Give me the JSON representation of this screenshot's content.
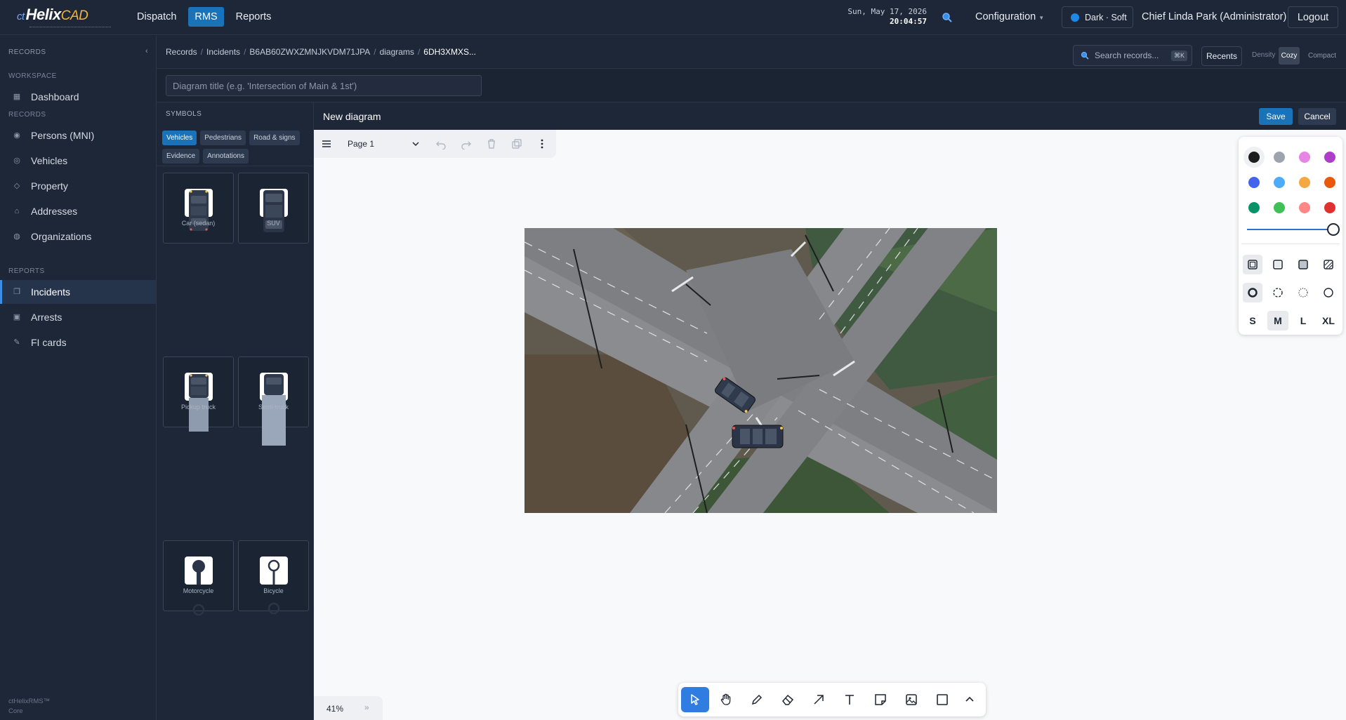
{
  "app": {
    "logo": {
      "prefix": "ct",
      "main": "Helix",
      "suffix": "CAD"
    },
    "nav": [
      {
        "label": "Dispatch",
        "active": false
      },
      {
        "label": "RMS",
        "active": true
      },
      {
        "label": "Reports",
        "active": false
      }
    ],
    "date": "Sun, May 17, 2026",
    "time": "20:04:57",
    "configuration": "Configuration",
    "theme": "Dark · Soft",
    "user": "Chief Linda Park (Administrator)",
    "logout": "Logout"
  },
  "sidebar": {
    "header": "RECORDS",
    "sections": {
      "workspace": "WORKSPACE",
      "records": "RECORDS",
      "reports": "REPORTS"
    },
    "items": [
      {
        "label": "Dashboard",
        "icon": "grid-icon"
      },
      {
        "label": "Persons (MNI)",
        "icon": "person-icon"
      },
      {
        "label": "Vehicles",
        "icon": "vehicle-icon"
      },
      {
        "label": "Property",
        "icon": "diamond-icon"
      },
      {
        "label": "Addresses",
        "icon": "home-icon"
      },
      {
        "label": "Organizations",
        "icon": "org-icon"
      },
      {
        "label": "Incidents",
        "icon": "incident-icon",
        "active": true
      },
      {
        "label": "Arrests",
        "icon": "arrest-icon"
      },
      {
        "label": "FI cards",
        "icon": "pen-icon"
      }
    ],
    "footer_name": "ctHelixRMS™",
    "footer_edition": "Core"
  },
  "breadcrumb": [
    "Records",
    "Incidents",
    "B6AB60ZWXZMNJKVDM71JPA",
    "diagrams",
    "6DH3XMXS..."
  ],
  "search": {
    "placeholder": "Search records...",
    "shortcut": "⌘K"
  },
  "recents": "Recents",
  "density": {
    "label": "Density",
    "options": [
      "Cozy",
      "Compact"
    ],
    "selected": "Cozy"
  },
  "title_input": {
    "placeholder": "Diagram title (e.g. 'Intersection of Main & 1st')",
    "value": ""
  },
  "symbols": {
    "header": "SYMBOLS",
    "tabs": [
      {
        "label": "Vehicles",
        "active": true
      },
      {
        "label": "Pedestrians",
        "active": false
      },
      {
        "label": "Road & signs",
        "active": false
      },
      {
        "label": "Evidence",
        "active": false
      },
      {
        "label": "Annotations",
        "active": false
      }
    ],
    "items": [
      "Car (sedan)",
      "SUV",
      "Pickup truck",
      "Semi-truck",
      "Motorcycle",
      "Bicycle"
    ]
  },
  "editor": {
    "title": "New diagram",
    "save": "Save",
    "cancel": "Cancel",
    "page": "Page 1",
    "zoom": "41%"
  },
  "style_panel": {
    "colors": [
      "#1d1d1d",
      "#9ea4ad",
      "#e685e3",
      "#ae3ec9",
      "#4263eb",
      "#4dabf7",
      "#f5a742",
      "#e8590c",
      "#099268",
      "#40c057",
      "#ff8787",
      "#e03131"
    ],
    "selected_color": "#1d1d1d",
    "opacity": 1,
    "sizes": [
      "S",
      "M",
      "L",
      "XL"
    ],
    "selected_size": "M"
  },
  "colors": {
    "accent": "#1a73b8",
    "tool_active": "#2f7de1",
    "background": "#1b2433"
  }
}
